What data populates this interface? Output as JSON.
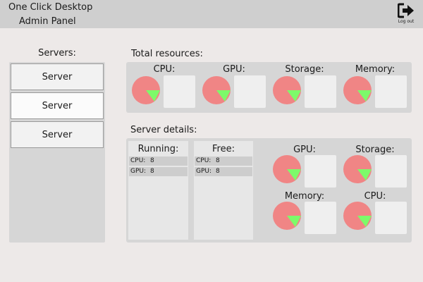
{
  "header": {
    "title": "One Click Desktop",
    "subtitle": "Admin Panel",
    "logout_label": "Log out",
    "logout_icon": "logout-icon"
  },
  "servers": {
    "title": "Servers:",
    "items": [
      {
        "label": "Server"
      },
      {
        "label": "Server"
      },
      {
        "label": "Server"
      }
    ]
  },
  "total_resources": {
    "title": "Total resources:",
    "items": [
      {
        "label": "CPU:"
      },
      {
        "label": "GPU:"
      },
      {
        "label": "Storage:"
      },
      {
        "label": "Memory:"
      }
    ]
  },
  "server_details": {
    "title": "Server details:",
    "running": {
      "title": "Running:",
      "rows": [
        {
          "key": "CPU:",
          "value": "8"
        },
        {
          "key": "GPU:",
          "value": "8"
        }
      ]
    },
    "free": {
      "title": "Free:",
      "rows": [
        {
          "key": "CPU:",
          "value": "8"
        },
        {
          "key": "GPU:",
          "value": "8"
        }
      ]
    },
    "resources": [
      {
        "label": "GPU:"
      },
      {
        "label": "Storage:"
      },
      {
        "label": "Memory:"
      },
      {
        "label": "CPU:"
      }
    ]
  },
  "colors": {
    "pie_used": "#f08585",
    "pie_free": "#7dfa6a",
    "header_bg": "#cfcfcf",
    "panel_bg": "#d6d6d6"
  }
}
